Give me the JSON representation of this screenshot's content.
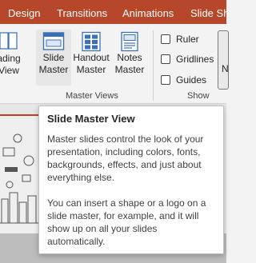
{
  "tabs": [
    "Design",
    "Transitions",
    "Animations",
    "Slide Sh"
  ],
  "ribbon": {
    "partial_left_label": [
      "ading",
      "View"
    ],
    "master_views": {
      "buttons": [
        {
          "label": [
            "Slide",
            "Master"
          ],
          "icon": "slide-master-icon"
        },
        {
          "label": [
            "Handout",
            "Master"
          ],
          "icon": "handout-master-icon"
        },
        {
          "label": [
            "Notes",
            "Master"
          ],
          "icon": "notes-master-icon"
        }
      ],
      "group_label": "Master Views"
    },
    "show": {
      "checkboxes": [
        "Ruler",
        "Gridlines",
        "Guides"
      ],
      "group_label": "Show"
    },
    "partial_right_label": "N"
  },
  "tooltip": {
    "title": "Slide Master View",
    "paragraph1": "Master slides control the look of your presentation, including colors, fonts, backgrounds, effects, and just about everything else.",
    "paragraph2": "You can insert a shape or a logo on a slide master, for example, and it will show up on all your slides automatically."
  },
  "colors": {
    "accent": "#b7472a",
    "selected": "#e6e6e6"
  }
}
